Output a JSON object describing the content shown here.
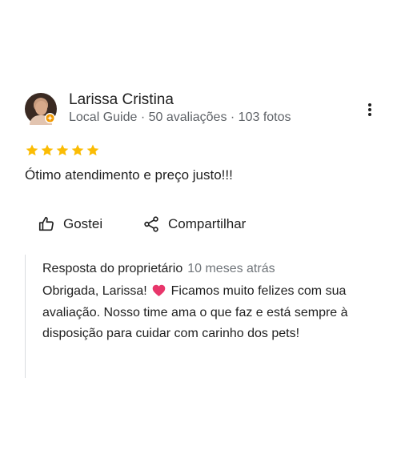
{
  "reviewer": {
    "name": "Larissa Cristina",
    "meta": "Local Guide · 50 avaliações · 103 fotos",
    "avatar_icon": "reviewer-avatar",
    "badge_icon": "local-guide-badge-icon"
  },
  "menu_icon": "more-vert-icon",
  "rating": {
    "stars": 5,
    "max": 5,
    "star_color": "#fbbc04"
  },
  "review": {
    "text": "Ótimo atendimento e preço justo!!!"
  },
  "actions": {
    "like_label": "Gostei",
    "like_icon": "thumb-up-icon",
    "share_label": "Compartilhar",
    "share_icon": "share-icon"
  },
  "owner_response": {
    "title": "Resposta do proprietário",
    "time": "10 meses atrás",
    "text_before": "Obrigada, Larissa!",
    "emoji": "heart-emoji",
    "text_after": "Ficamos muito felizes com sua avaliação. Nosso time ama o que faz e está sempre à disposição para cuidar com carinho dos pets!"
  },
  "colors": {
    "text_primary": "#1f1f1f",
    "text_secondary": "#5f6368",
    "star": "#fbbc04",
    "heart": "#e8366b",
    "divider": "#dadce0"
  }
}
